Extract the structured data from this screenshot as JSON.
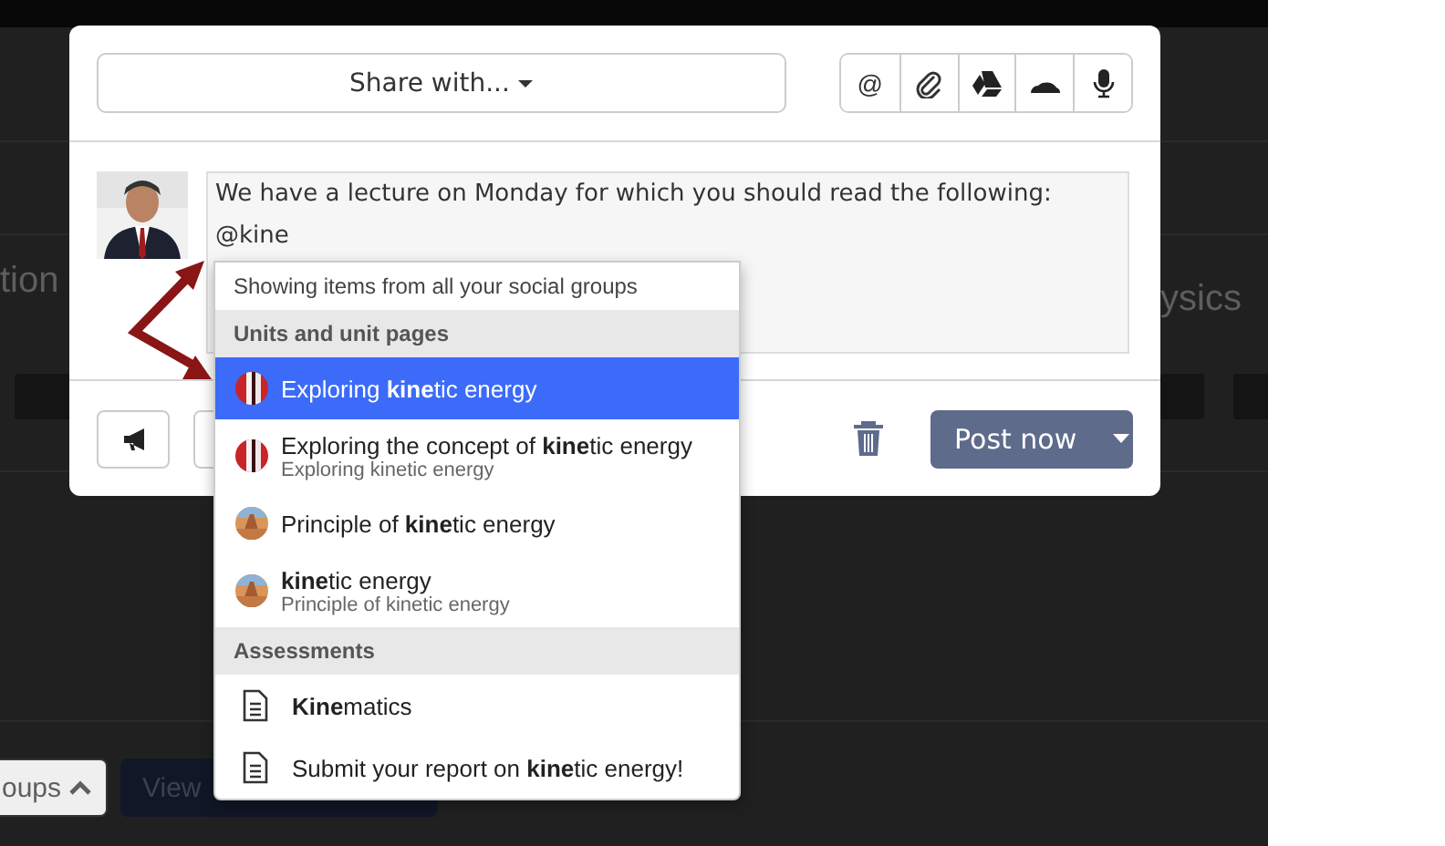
{
  "background": {
    "left_heading": "tion",
    "right_heading": "ysics",
    "groups_button": "oups",
    "view_button": "View"
  },
  "composer": {
    "share_button": "Share with...",
    "tools": [
      {
        "kind": "mention",
        "glyph": "@"
      },
      {
        "kind": "attach"
      },
      {
        "kind": "drive"
      },
      {
        "kind": "cloud"
      },
      {
        "kind": "mic"
      }
    ],
    "message_lines": [
      "We have a lecture on Monday for which you should read the following:",
      "@kine"
    ],
    "post_button": "Post now"
  },
  "mention_menu": {
    "hint": "Showing items from all your social groups",
    "groups": [
      {
        "title": "Units and unit pages",
        "items": [
          {
            "kind": "stripes",
            "title": "Exploring **kine**tic energy",
            "selected": true
          },
          {
            "kind": "stripes",
            "title": "Exploring the concept of **kine**tic energy",
            "subtitle": "Exploring kinetic energy",
            "selected": false
          },
          {
            "title": "Principle of **kine**tic energy",
            "selected": false
          },
          {
            "title": "**kine**tic energy",
            "subtitle": "Principle of kinetic energy",
            "selected": false
          }
        ]
      },
      {
        "title": "Assessments",
        "items": [
          {
            "kind": "document",
            "title": "**Kine**matics",
            "selected": false
          },
          {
            "kind": "document",
            "title": "Submit your report on **kine**tic energy!",
            "selected": false
          }
        ]
      }
    ]
  }
}
